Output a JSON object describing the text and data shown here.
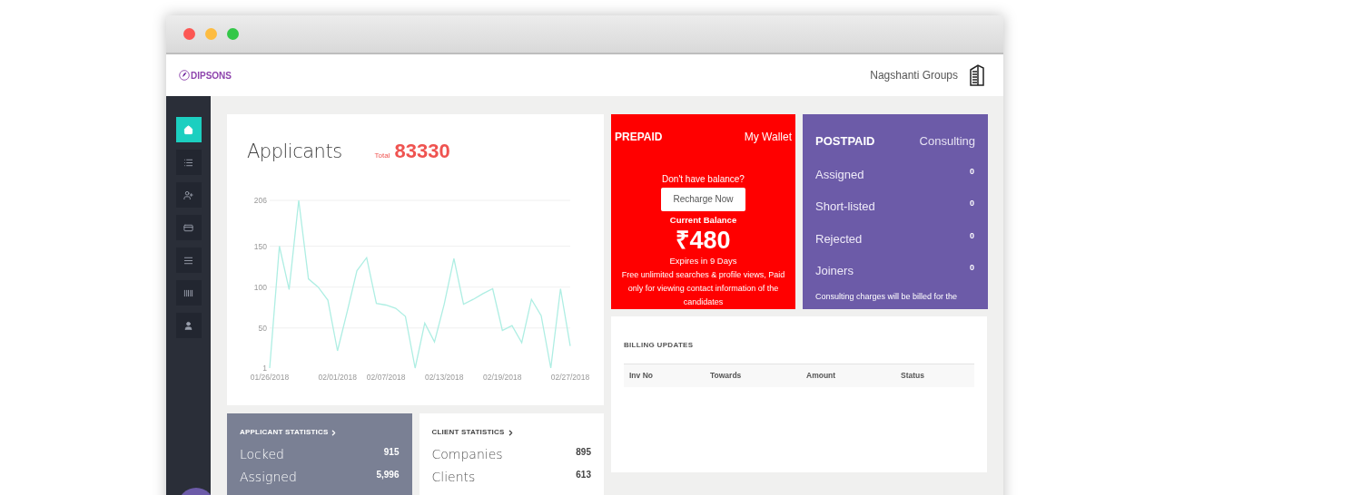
{
  "header": {
    "logo": "DIPSONS",
    "company": "Nagshanti Groups"
  },
  "sidebar": {
    "items": [
      {
        "selected": true
      },
      {
        "selected": false
      },
      {
        "selected": false
      },
      {
        "selected": false
      },
      {
        "selected": false
      },
      {
        "selected": false
      },
      {
        "selected": false
      }
    ]
  },
  "applicants": {
    "title": "Applicants",
    "total_label": "Total",
    "total": "83330",
    "chart_data": {
      "type": "line",
      "grid": true,
      "categories": [
        "01/26/2018",
        null,
        null,
        null,
        null,
        null,
        null,
        "02/01/2018",
        null,
        null,
        null,
        null,
        "02/07/2018",
        null,
        null,
        null,
        null,
        null,
        "02/13/2018",
        null,
        null,
        null,
        null,
        null,
        "02/19/2018",
        null,
        null,
        null,
        null,
        null,
        null,
        "02/27/2018"
      ],
      "series": [
        {
          "color": "#aeeee3",
          "values": [
            1,
            150,
            97,
            206,
            110,
            100,
            84,
            22,
            70,
            120,
            136,
            80,
            78,
            74,
            64,
            1,
            56,
            33,
            79,
            135,
            79,
            85,
            92,
            98,
            47,
            53,
            32,
            85,
            65,
            1,
            98,
            28
          ]
        }
      ],
      "ylim": [
        1,
        206
      ],
      "yticks": [
        1,
        50,
        100,
        150,
        206
      ]
    }
  },
  "prepaid": {
    "title": "PREPAID",
    "subtitle": "My Wallet",
    "prompt": "Don't have balance?",
    "button": "Recharge Now",
    "balance_label": "Current Balance",
    "balance": "₹480",
    "expiry": "Expires in 9 Days",
    "note": "Free unlimited searches & profile views, Paid only for viewing contact information of the candidates"
  },
  "postpaid": {
    "title": "POSTPAID",
    "subtitle": "Consulting",
    "rows": [
      {
        "label": "Assigned",
        "value": "0"
      },
      {
        "label": "Short-listed",
        "value": "0"
      },
      {
        "label": "Rejected",
        "value": "0"
      },
      {
        "label": "Joiners",
        "value": "0"
      }
    ],
    "note": "Consulting charges will be billed for the"
  },
  "billing": {
    "title": "BILLING UPDATES",
    "columns": [
      "Inv No",
      "Towards",
      "Amount",
      "Status"
    ]
  },
  "applicant_statistics": {
    "title": "APPLICANT STATISTICS",
    "rows": [
      {
        "label": "Locked",
        "value": "915"
      },
      {
        "label": "Assigned",
        "value": "5,996"
      }
    ]
  },
  "client_statistics": {
    "title": "CLIENT STATISTICS",
    "rows": [
      {
        "label": "Companies",
        "value": "895"
      },
      {
        "label": "Clients",
        "value": "613"
      }
    ]
  }
}
